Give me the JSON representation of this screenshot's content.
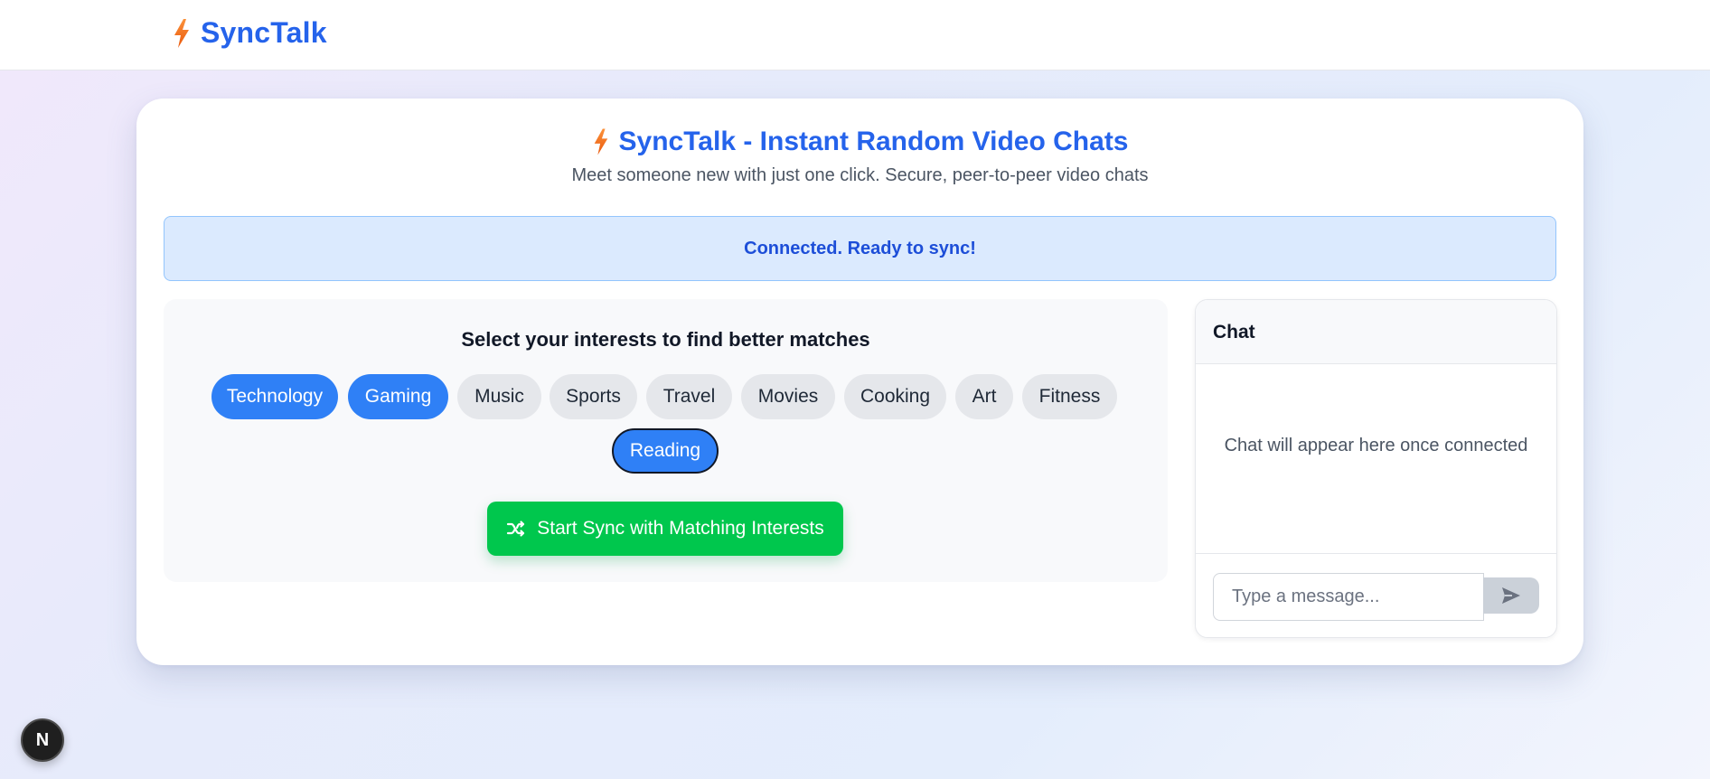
{
  "topbar": {
    "logo_text": "SyncTalk",
    "logo_icon": "bolt-icon"
  },
  "hero": {
    "title": "SyncTalk - Instant Random Video Chats",
    "subtitle": "Meet someone new with just one click. Secure, peer-to-peer video chats",
    "icon": "bolt-icon"
  },
  "status": {
    "message": "Connected. Ready to sync!"
  },
  "interests": {
    "heading": "Select your interests to find better matches",
    "chips": [
      {
        "label": "Technology",
        "selected": true
      },
      {
        "label": "Gaming",
        "selected": true
      },
      {
        "label": "Music",
        "selected": false
      },
      {
        "label": "Sports",
        "selected": false
      },
      {
        "label": "Travel",
        "selected": false
      },
      {
        "label": "Movies",
        "selected": false
      },
      {
        "label": "Cooking",
        "selected": false
      },
      {
        "label": "Art",
        "selected": false
      },
      {
        "label": "Fitness",
        "selected": false
      },
      {
        "label": "Reading",
        "selected": true,
        "focused": true
      }
    ],
    "start_button": "Start Sync with Matching Interests",
    "start_icon": "shuffle-icon"
  },
  "chat": {
    "title": "Chat",
    "empty_message": "Chat will appear here once connected",
    "input_placeholder": "Type a message...",
    "input_value": "",
    "send_icon": "send-icon"
  },
  "dev_badge": {
    "label": "N"
  },
  "colors": {
    "brand_blue": "#2563eb",
    "bolt_orange": "#f97316",
    "chip_selected": "#2f80f6",
    "chip_unselected": "#e5e7eb",
    "start_green": "#00c74d",
    "status_bg": "#dbeafe"
  }
}
